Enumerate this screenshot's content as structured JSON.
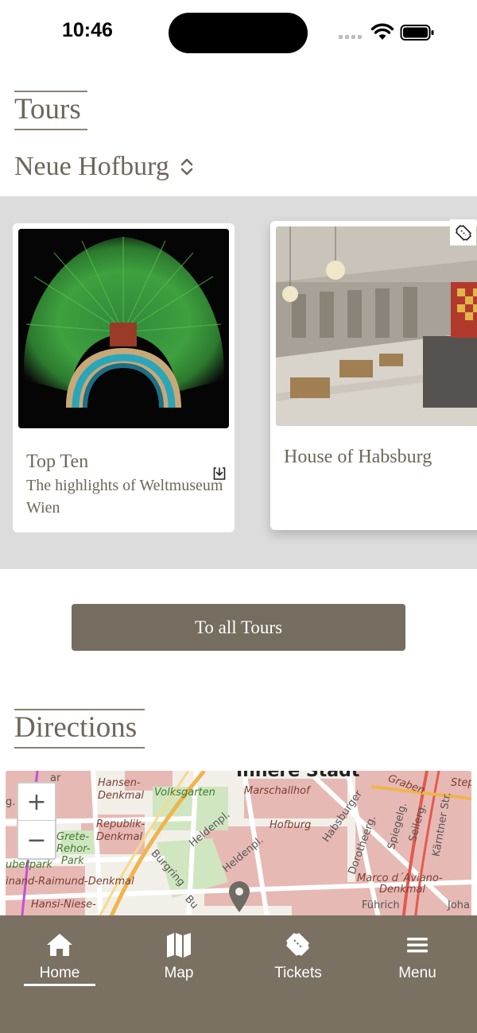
{
  "status_bar": {
    "time": "10:46"
  },
  "tours": {
    "title": "Tours",
    "location": "Neue Hofburg",
    "cards": [
      {
        "title": "Top Ten",
        "subtitle": "The highlights of Weltmuseum Wien",
        "badge": "download-icon"
      },
      {
        "title": "House of Habsburg",
        "subtitle": "",
        "badge": "ticket-icon"
      }
    ],
    "all_tours_label": "To all Tours"
  },
  "directions": {
    "title": "Directions",
    "map": {
      "zoom_in_label": "+",
      "zoom_out_label": "−",
      "labels": {
        "innere_stadt": "Innere Stadt",
        "hansen": "Hansen-",
        "hansen2": "Denkmal",
        "volksgarten": "Volksgarten",
        "marschallhof": "Marschallhof",
        "republik": "Republik-",
        "republik2": "Denkmal",
        "grete": "Grete-",
        "rehor": "Rehor-",
        "park": "Park",
        "hofburg": "Hofburg",
        "heldenpl1": "Heldenpl.",
        "heldenpl2": "Heldenpl.",
        "burgring": "Burgring",
        "bu": "Bu",
        "uberpark": "uberpark",
        "raimund": "inand-Raimund-Denkmal",
        "hansi": "Hansi-Niese-",
        "habsburger": "Habsburger",
        "dorotheerg": "Dorotheerg.",
        "spiegelg": "Spiegelg.",
        "seilerg": "Seilerg.",
        "kaertner": "Kärntner Str.",
        "graben": "Graben",
        "step": "Step",
        "marco": "Marco d´Aviano-",
        "marco2": "Denkmal",
        "fuehrich": "Führich",
        "joha": "Joha",
        "g": "g.",
        "ar": "ar"
      }
    }
  },
  "tab_bar": {
    "items": [
      {
        "label": "Home",
        "icon": "home-icon",
        "active": true
      },
      {
        "label": "Map",
        "icon": "map-icon",
        "active": false
      },
      {
        "label": "Tickets",
        "icon": "ticket-icon",
        "active": false
      },
      {
        "label": "Menu",
        "icon": "menu-icon",
        "active": false
      }
    ]
  },
  "colors": {
    "accent": "#756d60",
    "tab_bar": "#7a7163",
    "text": "#6e665a",
    "carousel_bg": "#dcdcdc"
  }
}
